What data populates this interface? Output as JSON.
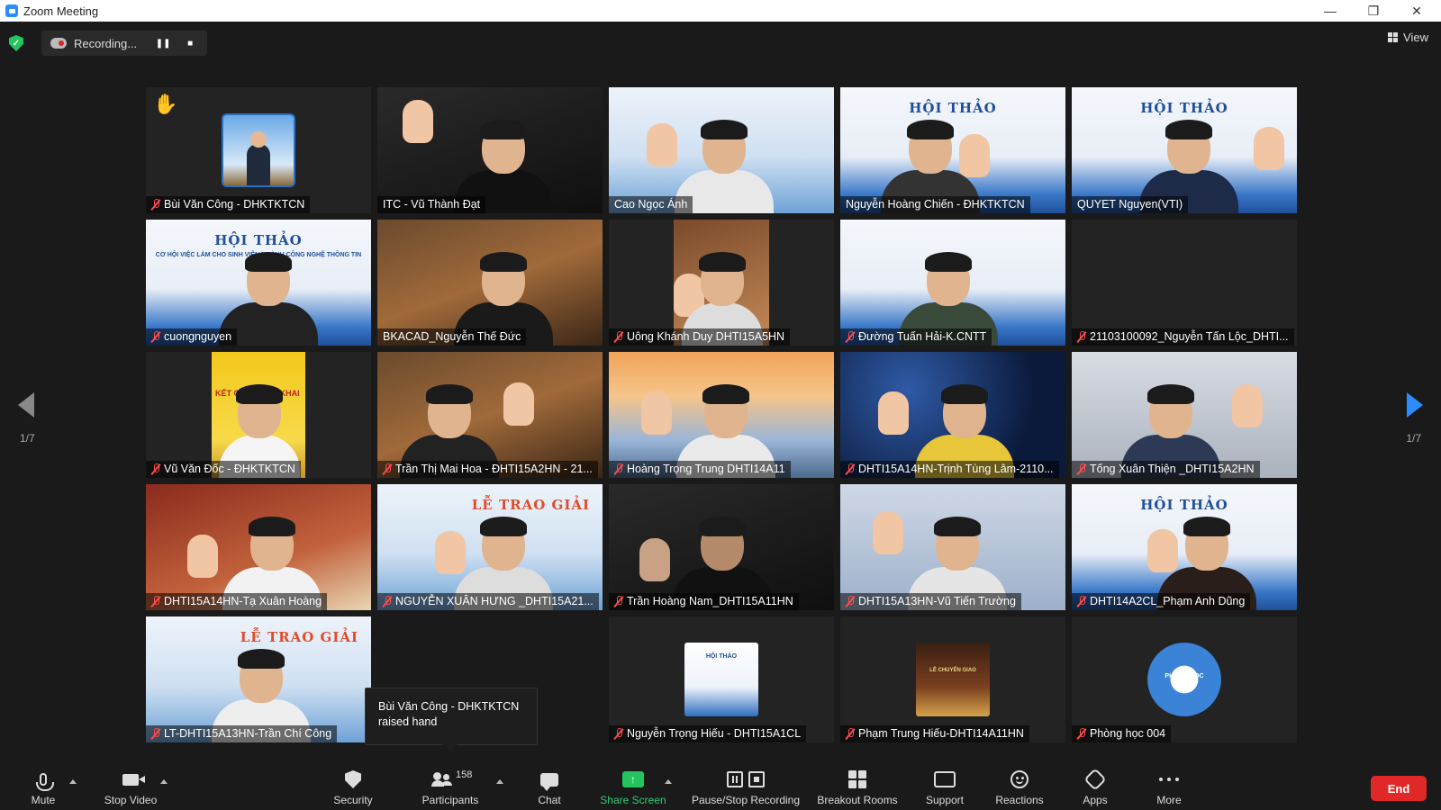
{
  "window": {
    "title": "Zoom Meeting"
  },
  "recording": {
    "label": "Recording..."
  },
  "view_label": "View",
  "page": {
    "left": "1/7",
    "right": "1/7"
  },
  "tiles": [
    {
      "name": "Bùi Văn Công - DHKTKTCN",
      "muted": true
    },
    {
      "name": "ITC - Vũ Thành Đạt",
      "muted": false
    },
    {
      "name": "Cao Ngọc Ánh",
      "muted": false
    },
    {
      "name": "Nguyễn Hoàng Chiến - ĐHKTKTCN",
      "muted": false
    },
    {
      "name": "QUYET Nguyen(VTI)",
      "muted": false
    },
    {
      "name": "cuongnguyen",
      "muted": true
    },
    {
      "name": "BKACAD_Nguyễn Thế Đức",
      "muted": false
    },
    {
      "name": "Uông Khánh Duy DHTI15A5HN",
      "muted": true
    },
    {
      "name": "Đường Tuấn Hải-K.CNTT",
      "muted": true
    },
    {
      "name": "21103100092_Nguyễn Tấn Lộc_DHTI...",
      "muted": true
    },
    {
      "name": "Vũ Văn Đốc - ĐHKTKTCN",
      "muted": true
    },
    {
      "name": "Trần Thị Mai Hoa - ĐHTI15A2HN - 21...",
      "muted": true
    },
    {
      "name": "Hoàng Trọng Trung DHTI14A11",
      "muted": true
    },
    {
      "name": "DHTI15A14HN-Trịnh Tùng Lâm-2110...",
      "muted": true
    },
    {
      "name": "Tống Xuân Thiện _DHTI15A2HN",
      "muted": true
    },
    {
      "name": "DHTI15A14HN-Tạ Xuân Hoàng",
      "muted": true
    },
    {
      "name": "NGUYỄN XUÂN HƯNG _DHTI15A21...",
      "muted": true
    },
    {
      "name": "Trần Hoàng Nam_DHTI15A11HN",
      "muted": true
    },
    {
      "name": "DHTI15A13HN-Vũ Tiến Trường",
      "muted": true
    },
    {
      "name": "DHTI14A2CL_Phạm Anh Dũng",
      "muted": true
    },
    {
      "name": "LT-DHTI15A13HN-Trần Chí Công",
      "muted": true
    },
    {
      "name": "",
      "muted": false
    },
    {
      "name": "Nguyễn Trọng Hiếu - DHTI15A1CL",
      "muted": true
    },
    {
      "name": "Phạm Trung Hiếu-DHTI14A11HN",
      "muted": true
    },
    {
      "name": "Phòng học 004",
      "muted": true
    }
  ],
  "banner": {
    "hoi_thao": "HỘI THẢO",
    "sub": "CƠ HỘI VIỆC LÀM CHO SINH VIÊN NGÀNH CÔNG NGHỆ THÔNG TIN",
    "le_trao_giai": "LỄ TRAO GIẢI",
    "poster": "KẾT CỦA TRIỂN KHAI",
    "room": "PHÒNG HỌC",
    "room_num": "SỐ 004"
  },
  "tooltip": {
    "line1": "Bùi Văn Công - DHKTKTCN",
    "line2": "raised hand"
  },
  "toolbar": {
    "mute": "Mute",
    "stop_video": "Stop Video",
    "security": "Security",
    "participants": "Participants",
    "participant_count": "158",
    "chat": "Chat",
    "share_screen": "Share Screen",
    "pause_stop_recording": "Pause/Stop Recording",
    "breakout_rooms": "Breakout Rooms",
    "support": "Support",
    "reactions": "Reactions",
    "apps": "Apps",
    "more": "More",
    "end": "End"
  },
  "colors": {
    "active_speaker": "#c6e84a",
    "end": "#e02828",
    "share": "#22c55e",
    "accent": "#2d8cff"
  }
}
